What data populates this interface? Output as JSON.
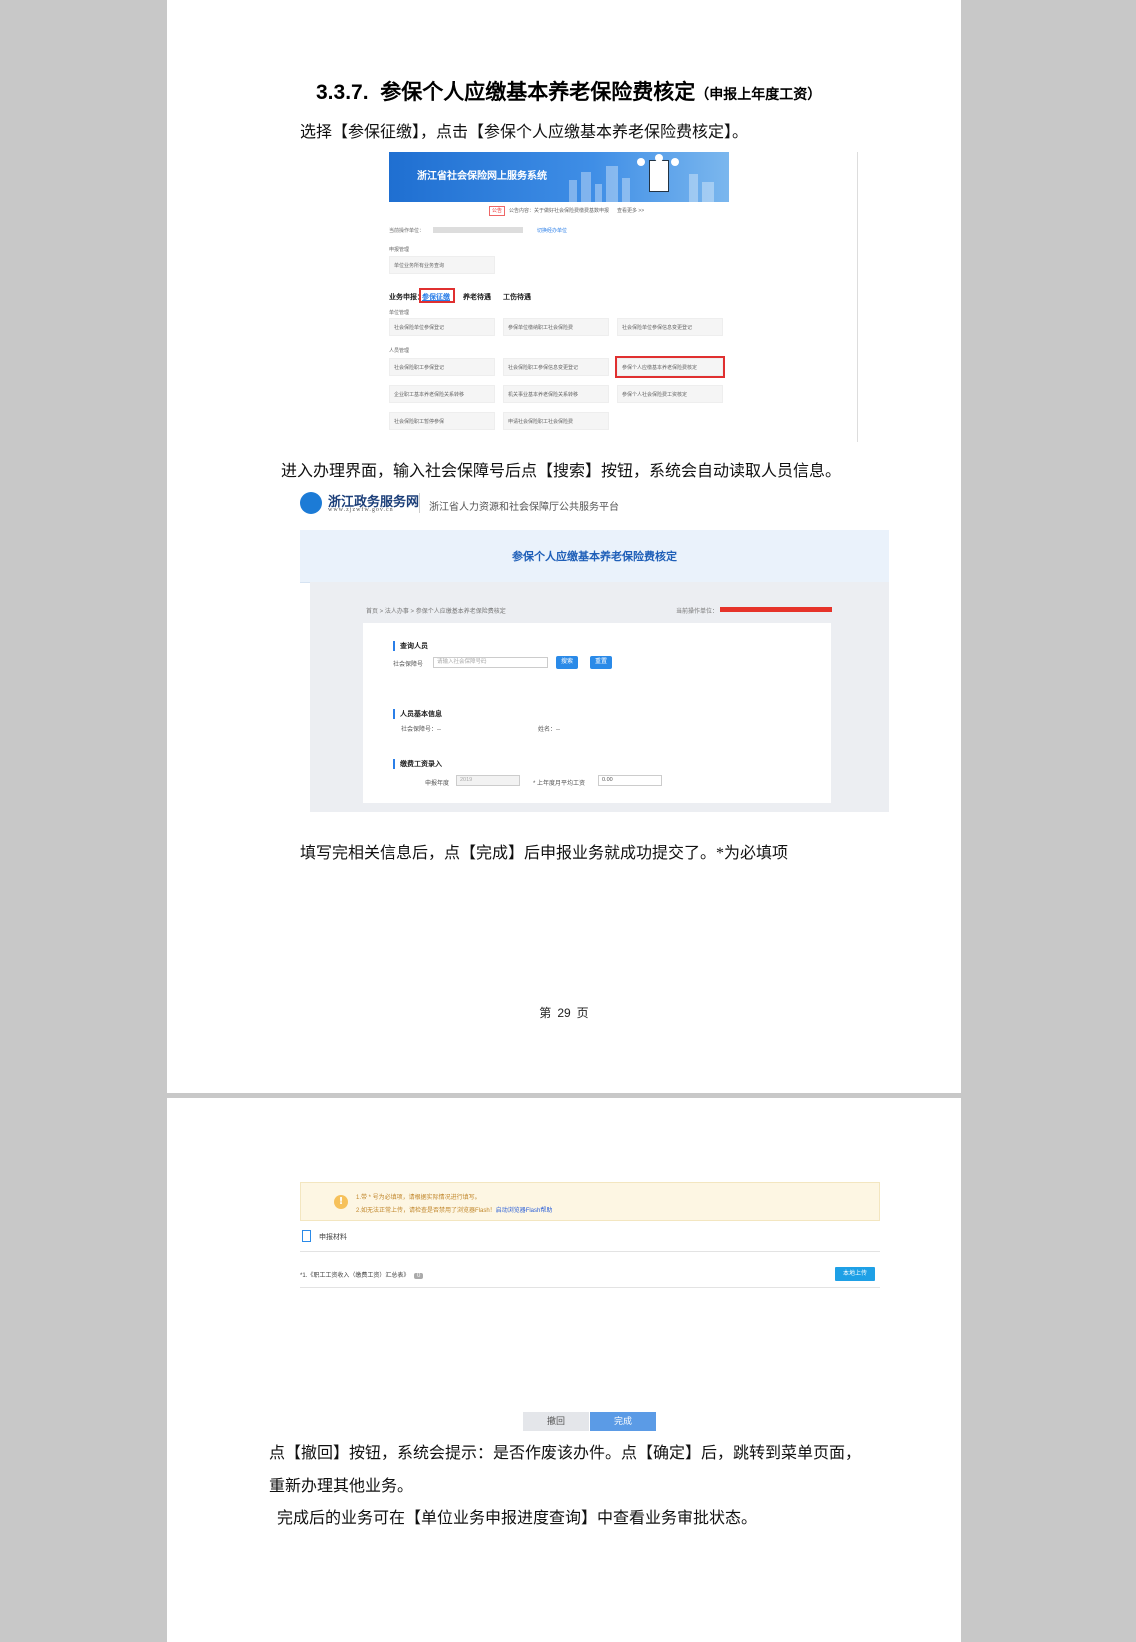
{
  "page1": {
    "heading": {
      "number": "3.3.7.",
      "title": "参保个人应缴基本养老保险费核定",
      "note": "（申报上年度工资）"
    },
    "para1": "选择【参保征缴】，点击【参保个人应缴基本养老保险费核定】。",
    "screenshot1": {
      "banner_title": "浙江省社会保险网上服务系统",
      "notice_tag": "公告",
      "notice_text": "公告内容：关于做好社会保险费缴费基数申报工作的通知...",
      "more": "查看更多 >>",
      "operator_label": "当前操作单位：",
      "switch_unit": "切换经办单位",
      "section_apply": "申报管理",
      "card_query": "单位业务所有业务查询",
      "business_label": "业务申报：",
      "tabs": [
        "参保征缴",
        "养老待遇",
        "工伤待遇"
      ],
      "unit_section": "单位管理",
      "unit_cards": [
        "社会保险单位参保登记",
        "参保单位缴纳职工社会保险费",
        "社会保险单位参保信息变更登记"
      ],
      "person_section": "人员管理",
      "person_cards": [
        "社会保险职工参保登记",
        "社会保险职工参保信息变更登记",
        "参保个人应缴基本养老保险费核定",
        "企业职工基本养老保险关系转移",
        "机关事业基本养老保险关系转移",
        "参保个人社会保险费工资核定",
        "社会保险职工暂停参保",
        "申请社会保险职工社会保险费"
      ]
    },
    "para2": "进入办理界面，输入社会保障号后点【搜索】按钮，系统会自动读取人员信息。",
    "screenshot2": {
      "logo_title": "浙江政务服务网",
      "logo_url": "www.zjzwfw.gov.cn",
      "platform": "浙江省人力资源和社会保障厅公共服务平台",
      "page_title": "参保个人应缴基本养老保险费核定",
      "breadcrumb": [
        "首页",
        "法人办事",
        "参保个人应缴基本养老保险费核定"
      ],
      "operator_label": "当前操作单位：",
      "sec_query": "查询人员",
      "ssn_label": "社会保障号",
      "ssn_placeholder": "请输入社会保障号码",
      "search_btn": "搜索",
      "reset_btn": "重置",
      "sec_basic": "人员基本信息",
      "basic_ssn": "社会保障号：--",
      "basic_name": "姓名：--",
      "sec_wage": "缴费工资录入",
      "year_label": "申报年度",
      "year_value": "2019",
      "avg_label": "* 上年度月平均工资",
      "avg_value": "0.00"
    },
    "para3": "填写完相关信息后，点【完成】后申报业务就成功提交了。*为必填项",
    "page_no": {
      "prefix": "第",
      "num": "29",
      "suffix": "页"
    }
  },
  "page2": {
    "notice1": "1.带 * 号为必填项，请根据实际情况进行填写。",
    "notice2a": "2.如无法正常上传，请检查是否禁用了浏览器Flash！",
    "notice2b": "启动浏览器Flash帮助",
    "materials": "申报材料",
    "item": "*1.《职工工资收入（缴费工资）汇总表》",
    "item_badge": "0",
    "upload": "本地上传",
    "withdraw": "撤回",
    "finish": "完成",
    "para1_line1": "点【撤回】按钮，系统会提示：是否作废该办件。点【确定】后，跳转到菜单页面，",
    "para1_line2": "重新办理其他业务。",
    "para2": "完成后的业务可在【单位业务申报进度查询】中查看业务审批状态。"
  },
  "colors": {
    "accent": "#2a8ae8",
    "red_highlight": "#e03030",
    "notice_bg": "#fdf6e3"
  }
}
